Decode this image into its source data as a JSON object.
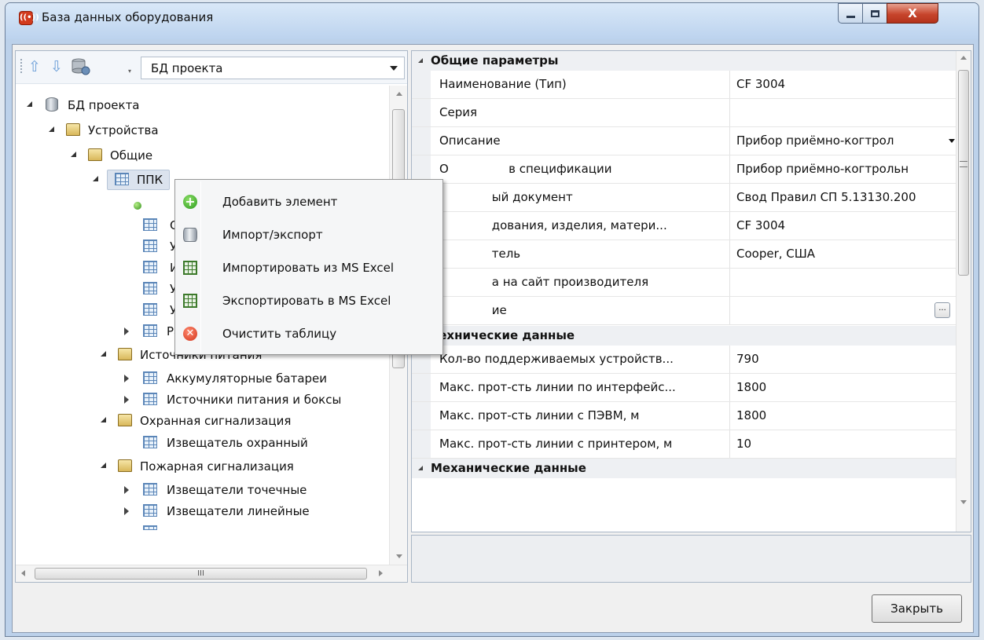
{
  "window": {
    "title": "База данных оборудования",
    "close_glyph": "X"
  },
  "toolbar": {
    "icons": [
      "arrow-up-icon",
      "arrow-down-icon",
      "database-settings-icon"
    ],
    "source_select_value": "БД проекта"
  },
  "tree": {
    "root": "БД проекта",
    "devices": "Устройства",
    "general": "Общие",
    "ppk": "ППК",
    "hidden_1": "С",
    "hidden_2": "У",
    "hidden_3": "И",
    "hidden_4": "У",
    "hidden_5": "У",
    "hidden_6": "Ра",
    "power_sources": "Источники питания",
    "batteries": "Аккумуляторные батареи",
    "power_boxes": "Источники питания и боксы",
    "security_alarm": "Охранная сигнализация",
    "security_detector": "Извещатель охранный",
    "fire_alarm": "Пожарная сигнализация",
    "point_detectors": "Извещатели точечные",
    "linear_detectors": "Извещатели линейные"
  },
  "scroll": {
    "h_thumb_grip": "III"
  },
  "context_menu": {
    "items": [
      {
        "label": "Добавить элемент",
        "icon": "add-icon"
      },
      {
        "label": "Импорт/экспорт",
        "icon": "database-icon"
      },
      {
        "label": "Импортировать из MS Excel",
        "icon": "excel-import-icon"
      },
      {
        "label": "Экспортировать в MS Excel",
        "icon": "excel-export-icon"
      },
      {
        "label": "Очистить таблицу",
        "icon": "clear-icon"
      }
    ]
  },
  "properties": {
    "general_header": "Общие параметры",
    "rows": [
      {
        "key": "Наименование (Тип)",
        "value": "CF 3004"
      },
      {
        "key": "Серия",
        "value": ""
      },
      {
        "key": "Описание",
        "value": "Прибор приёмно-когтрол"
      },
      {
        "key": "О                в спецификации",
        "value": "Прибор приёмно-когтрольн"
      },
      {
        "key": "              ый документ",
        "value": "Свод Правил СП 5.13130.200"
      },
      {
        "key": "              дования, изделия, матери...",
        "value": "CF 3004"
      },
      {
        "key": "              тель",
        "value": "Cooper, США"
      },
      {
        "key": "              а на сайт производителя",
        "value": ""
      },
      {
        "key": "              ие",
        "value": ""
      }
    ],
    "ellipsis": "...",
    "tech_header": "Технические данные",
    "tech_rows": [
      {
        "key": "Кол-во поддерживаемых устройств...",
        "value": "790"
      },
      {
        "key": "Макс. прот-сть линии по интерфейс...",
        "value": "1800"
      },
      {
        "key": "Макс. прот-сть линии с ПЭВМ, м",
        "value": "1800"
      },
      {
        "key": "Макс. прот-сть линии с принтером, м",
        "value": "10"
      }
    ],
    "mech_header": "Механические данные"
  },
  "footer": {
    "close_label": "Закрыть"
  }
}
